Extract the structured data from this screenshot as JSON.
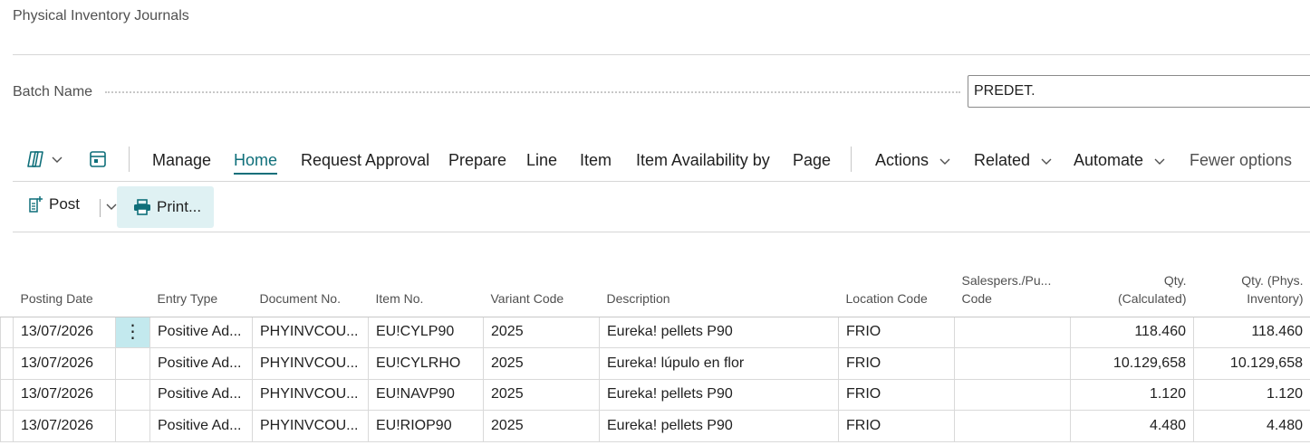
{
  "page": {
    "title": "Physical Inventory Journals"
  },
  "batch": {
    "label": "Batch Name",
    "value": "PREDET."
  },
  "menu": {
    "items": [
      {
        "label": "Manage"
      },
      {
        "label": "Home"
      },
      {
        "label": "Request Approval"
      },
      {
        "label": "Prepare"
      },
      {
        "label": "Line"
      },
      {
        "label": "Item"
      },
      {
        "label": "Item Availability by"
      },
      {
        "label": "Page"
      }
    ],
    "actions_label": "Actions",
    "related_label": "Related",
    "automate_label": "Automate",
    "fewer_label": "Fewer options"
  },
  "actions": {
    "post_label": "Post",
    "print_label": "Print..."
  },
  "table": {
    "headers": {
      "posting_date": "Posting Date",
      "entry_type": "Entry Type",
      "document_no": "Document No.",
      "item_no": "Item No.",
      "variant_code": "Variant Code",
      "description": "Description",
      "location_code": "Location Code",
      "salesperson_1": "Salespers./Pu...",
      "salesperson_2": "Code",
      "qty_calc_1": "Qty.",
      "qty_calc_2": "(Calculated)",
      "qty_phys_1": "Qty. (Phys.",
      "qty_phys_2": "Inventory)"
    },
    "rows": [
      {
        "posting_date": "13/07/2026",
        "entry_type": "Positive Ad...",
        "document_no": "PHYINVCOU...",
        "item_no": "EU!CYLP90",
        "variant_code": "2025",
        "description": "Eureka! pellets P90",
        "location_code": "FRIO",
        "salesperson": "",
        "qty_calculated": "118.460",
        "qty_phys": "118.460"
      },
      {
        "posting_date": "13/07/2026",
        "entry_type": "Positive Ad...",
        "document_no": "PHYINVCOU...",
        "item_no": "EU!CYLRHO",
        "variant_code": "2025",
        "description": "Eureka! lúpulo en flor",
        "location_code": "FRIO",
        "salesperson": "",
        "qty_calculated": "10.129,658",
        "qty_phys": "10.129,658"
      },
      {
        "posting_date": "13/07/2026",
        "entry_type": "Positive Ad...",
        "document_no": "PHYINVCOU...",
        "item_no": "EU!NAVP90",
        "variant_code": "2025",
        "description": "Eureka! pellets P90",
        "location_code": "FRIO",
        "salesperson": "",
        "qty_calculated": "1.120",
        "qty_phys": "1.120"
      },
      {
        "posting_date": "13/07/2026",
        "entry_type": "Positive Ad...",
        "document_no": "PHYINVCOU...",
        "item_no": "EU!RIOP90",
        "variant_code": "2025",
        "description": "Eureka! pellets P90",
        "location_code": "FRIO",
        "salesperson": "",
        "qty_calculated": "4.480",
        "qty_phys": "4.480"
      }
    ]
  },
  "icons": {
    "copilot": "copilot-icon",
    "personalize": "personalize-icon",
    "post": "post-icon",
    "print": "printer-icon",
    "chevron": "chevron-down-icon",
    "row_actions": "more-vertical-icon"
  },
  "colors": {
    "accent": "#0f6f7a",
    "selected_highlight": "#c3e9ee",
    "print_button_bg": "#dff1f3"
  }
}
